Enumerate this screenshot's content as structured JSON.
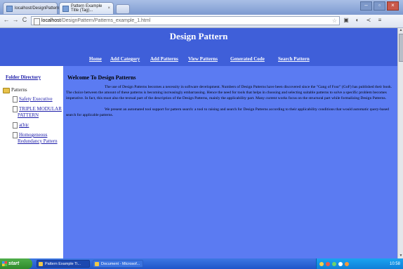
{
  "browser": {
    "tabs": [
      {
        "title": "localhost/DesignPattern/D...",
        "close": "×"
      },
      {
        "title": "Pattern Example Title (Tag)...",
        "close": "×"
      }
    ],
    "url_host": "localhost",
    "url_path": "/DesignPattern/Patterns_example_1.html",
    "nav": {
      "back": "←",
      "forward": "→",
      "reload": "C"
    },
    "window_buttons": {
      "minimize": "–",
      "maximize": "▫",
      "close": "×"
    },
    "toolbar_icons": [
      "☆",
      "▣",
      "◐",
      "≺",
      "≡"
    ]
  },
  "page": {
    "site_title": "Design Pattern",
    "nav_links": [
      "Home",
      "Add Category",
      "Add Patterns",
      "View Patterns",
      "Generated Code",
      "Search Pattern"
    ],
    "sidebar": {
      "directory_link": "Folder Directory",
      "tree": [
        {
          "label": "Patterns",
          "type": "folder"
        },
        {
          "label": "Safety Executive",
          "type": "doc"
        },
        {
          "label": "TRIPLE MODULAR",
          "type": "doc"
        },
        {
          "label": "PATTERN",
          "type": "cont"
        },
        {
          "label": "a(b)c",
          "type": "doc"
        },
        {
          "label": "Homogeneous",
          "type": "doc"
        },
        {
          "label": "Redundancy Pattern",
          "type": "cont"
        }
      ]
    },
    "main": {
      "heading": "Welcome To Design Patterns",
      "paragraph1": "The use of Design Patterns becomes a necessity in software development. Numbers of Design Patterns have been discovered since the \"Gang of Four\" (GoF) has published their book. The choice between the amount of these patterns is becoming increasingly embarrassing. Hence the need for tools that helps in choosing and selecting suitable patterns to solve a specific problem becomes imperative. In fact, this must also the textual part of the description of the Design Patterns, mainly the applicability part. Many current works focus on the structural part while formalizing Design Patterns.",
      "paragraph2": "We present an automated tool support for pattern search: a tool to raising and search for Design Patterns according to their applicability conditions that would automatic query-based search for applicable patterns."
    }
  },
  "taskbar": {
    "start_label": "start",
    "buttons": [
      "Pattern Example Ti...",
      "Document - Microsof..."
    ],
    "clock": "10:58"
  }
}
